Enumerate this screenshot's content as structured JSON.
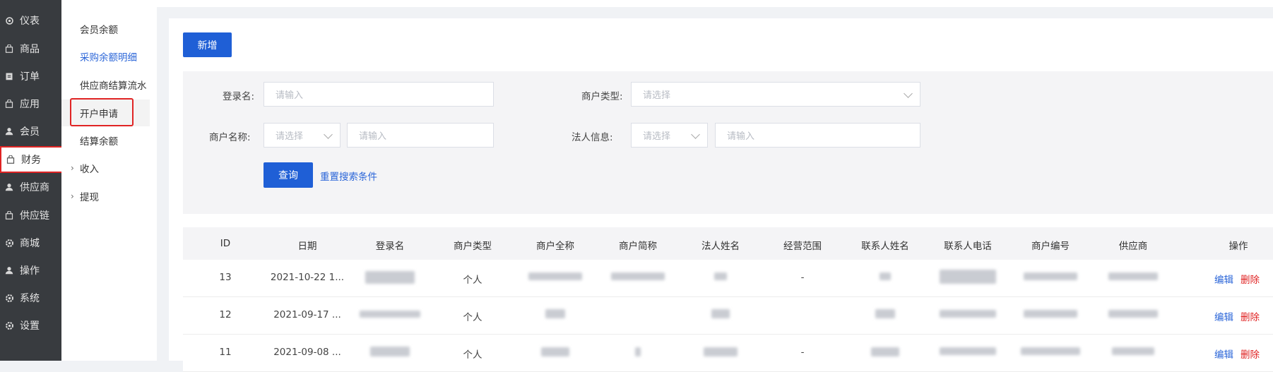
{
  "sidebar": {
    "items": [
      {
        "label": "仪表",
        "icon": "gear-icon"
      },
      {
        "label": "商品",
        "icon": "bag-icon"
      },
      {
        "label": "订单",
        "icon": "clipboard-icon"
      },
      {
        "label": "应用",
        "icon": "bag-icon"
      },
      {
        "label": "会员",
        "icon": "user-icon"
      },
      {
        "label": "财务",
        "icon": "bag-icon",
        "active": true
      },
      {
        "label": "供应商",
        "icon": "user-icon"
      },
      {
        "label": "供应链",
        "icon": "bag-icon"
      },
      {
        "label": "商城",
        "icon": "gear-icon"
      },
      {
        "label": "操作",
        "icon": "user-icon"
      },
      {
        "label": "系统",
        "icon": "gear-icon"
      },
      {
        "label": "设置",
        "icon": "gear-icon"
      }
    ]
  },
  "subnav": {
    "items": [
      {
        "label": "会员余额"
      },
      {
        "label": "采购余额明细"
      },
      {
        "label": "供应商结算流水"
      },
      {
        "label": "开户申请"
      },
      {
        "label": "结算余额"
      },
      {
        "label": "收入"
      },
      {
        "label": "提现"
      }
    ]
  },
  "toolbar": {
    "add_label": "新增"
  },
  "filter": {
    "login_label": "登录名:",
    "login_placeholder": "请输入",
    "merchant_type_label": "商户类型:",
    "merchant_type_placeholder": "请选择",
    "merchant_name_label": "商户名称:",
    "merchant_name_select_placeholder": "请选择",
    "merchant_name_input_placeholder": "请输入",
    "legal_info_label": "法人信息:",
    "legal_info_select_placeholder": "请选择",
    "legal_info_input_placeholder": "请输入",
    "search_label": "查询",
    "reset_label": "重置搜索条件"
  },
  "table": {
    "headers": [
      "ID",
      "日期",
      "登录名",
      "商户类型",
      "商户全称",
      "商户简称",
      "法人姓名",
      "经营范围",
      "联系人姓名",
      "联系人电话",
      "商户编号",
      "供应商",
      "操作"
    ],
    "rows": [
      {
        "id": "13",
        "date": "2021-10-22 1...",
        "type": "个人",
        "scope": "-"
      },
      {
        "id": "12",
        "date": "2021-09-17 ...",
        "type": "个人",
        "scope": ""
      },
      {
        "id": "11",
        "date": "2021-09-08 ...",
        "type": "个人",
        "scope": "-"
      }
    ],
    "edit_label": "编辑",
    "delete_label": "删除"
  },
  "colors": {
    "sidebar_bg": "#383b3f",
    "primary": "#1f5fd6",
    "danger": "#e02424",
    "link": "#2a65d8"
  }
}
